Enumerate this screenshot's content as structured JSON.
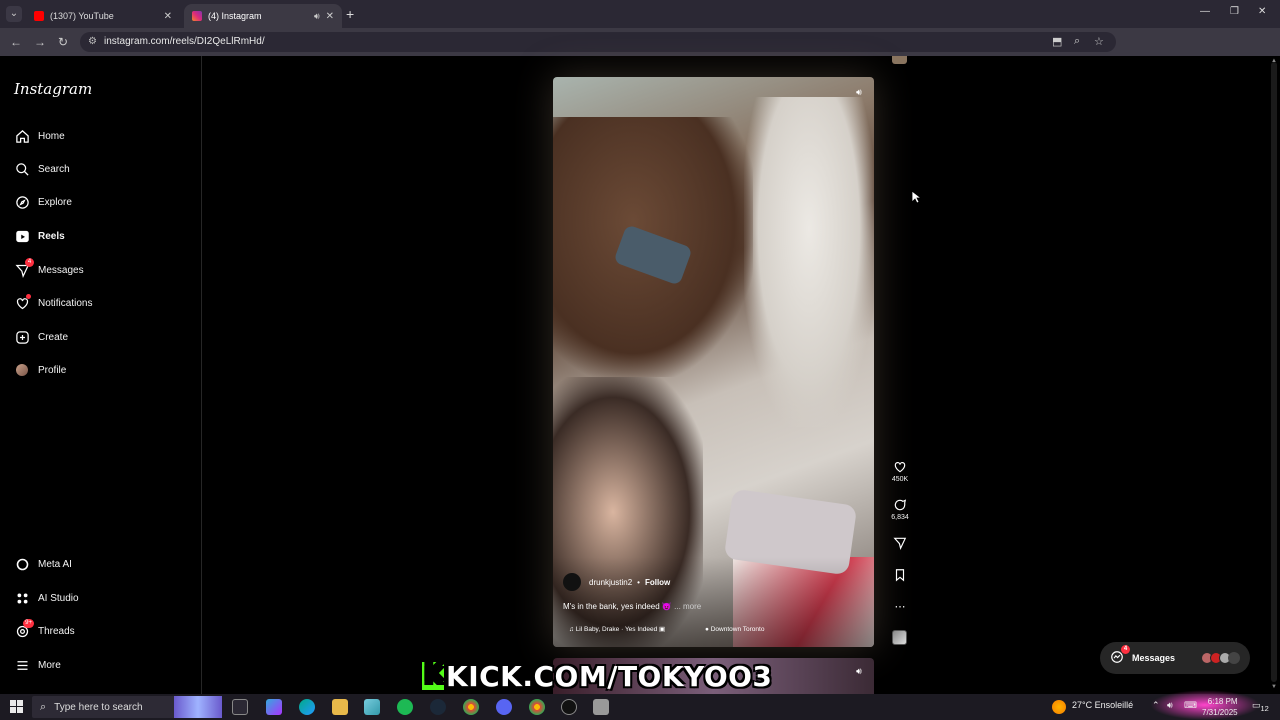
{
  "browser": {
    "tabs": [
      {
        "title": "(1307) YouTube",
        "active": false
      },
      {
        "title": "(4) Instagram",
        "active": true
      }
    ],
    "url": "instagram.com/reels/DI2QeLlRmHd/"
  },
  "sidebar": {
    "logo": "Instagram",
    "items": [
      {
        "label": "Home",
        "icon": "home-icon"
      },
      {
        "label": "Search",
        "icon": "search-icon"
      },
      {
        "label": "Explore",
        "icon": "compass-icon"
      },
      {
        "label": "Reels",
        "icon": "reels-icon",
        "active": true
      },
      {
        "label": "Messages",
        "icon": "messenger-icon",
        "badge": "4"
      },
      {
        "label": "Notifications",
        "icon": "heart-icon"
      },
      {
        "label": "Create",
        "icon": "plus-square-icon"
      },
      {
        "label": "Profile",
        "icon": "avatar-icon"
      }
    ],
    "bottom_items": [
      {
        "label": "Meta AI",
        "icon": "meta-ai-icon"
      },
      {
        "label": "AI Studio",
        "icon": "ai-studio-icon"
      },
      {
        "label": "Threads",
        "icon": "threads-icon",
        "badge": "9+"
      },
      {
        "label": "More",
        "icon": "menu-icon"
      }
    ]
  },
  "reel": {
    "username": "drunkjustin2",
    "follow_label": "Follow",
    "caption": "M's in the bank, yes indeed 😈",
    "more_label": "... more",
    "audio": "Lil Baby, Drake · Yes Indeed",
    "location": "Downtown Toronto",
    "likes": "450K",
    "comments": "6,834"
  },
  "messages_pill": {
    "label": "Messages",
    "badge": "4"
  },
  "overlay": {
    "kick_text": "KICK.COM/TOKYOO3"
  },
  "taskbar": {
    "search_placeholder": "Type here to search",
    "weather": "27°C  Ensoleillé",
    "time": "6:18 PM",
    "date": "7/31/2025",
    "notif_count": "12"
  },
  "colors": {
    "accent_kick": "#53fc18",
    "badge_red": "#ff3040",
    "chrome_dark": "#2b2834"
  }
}
